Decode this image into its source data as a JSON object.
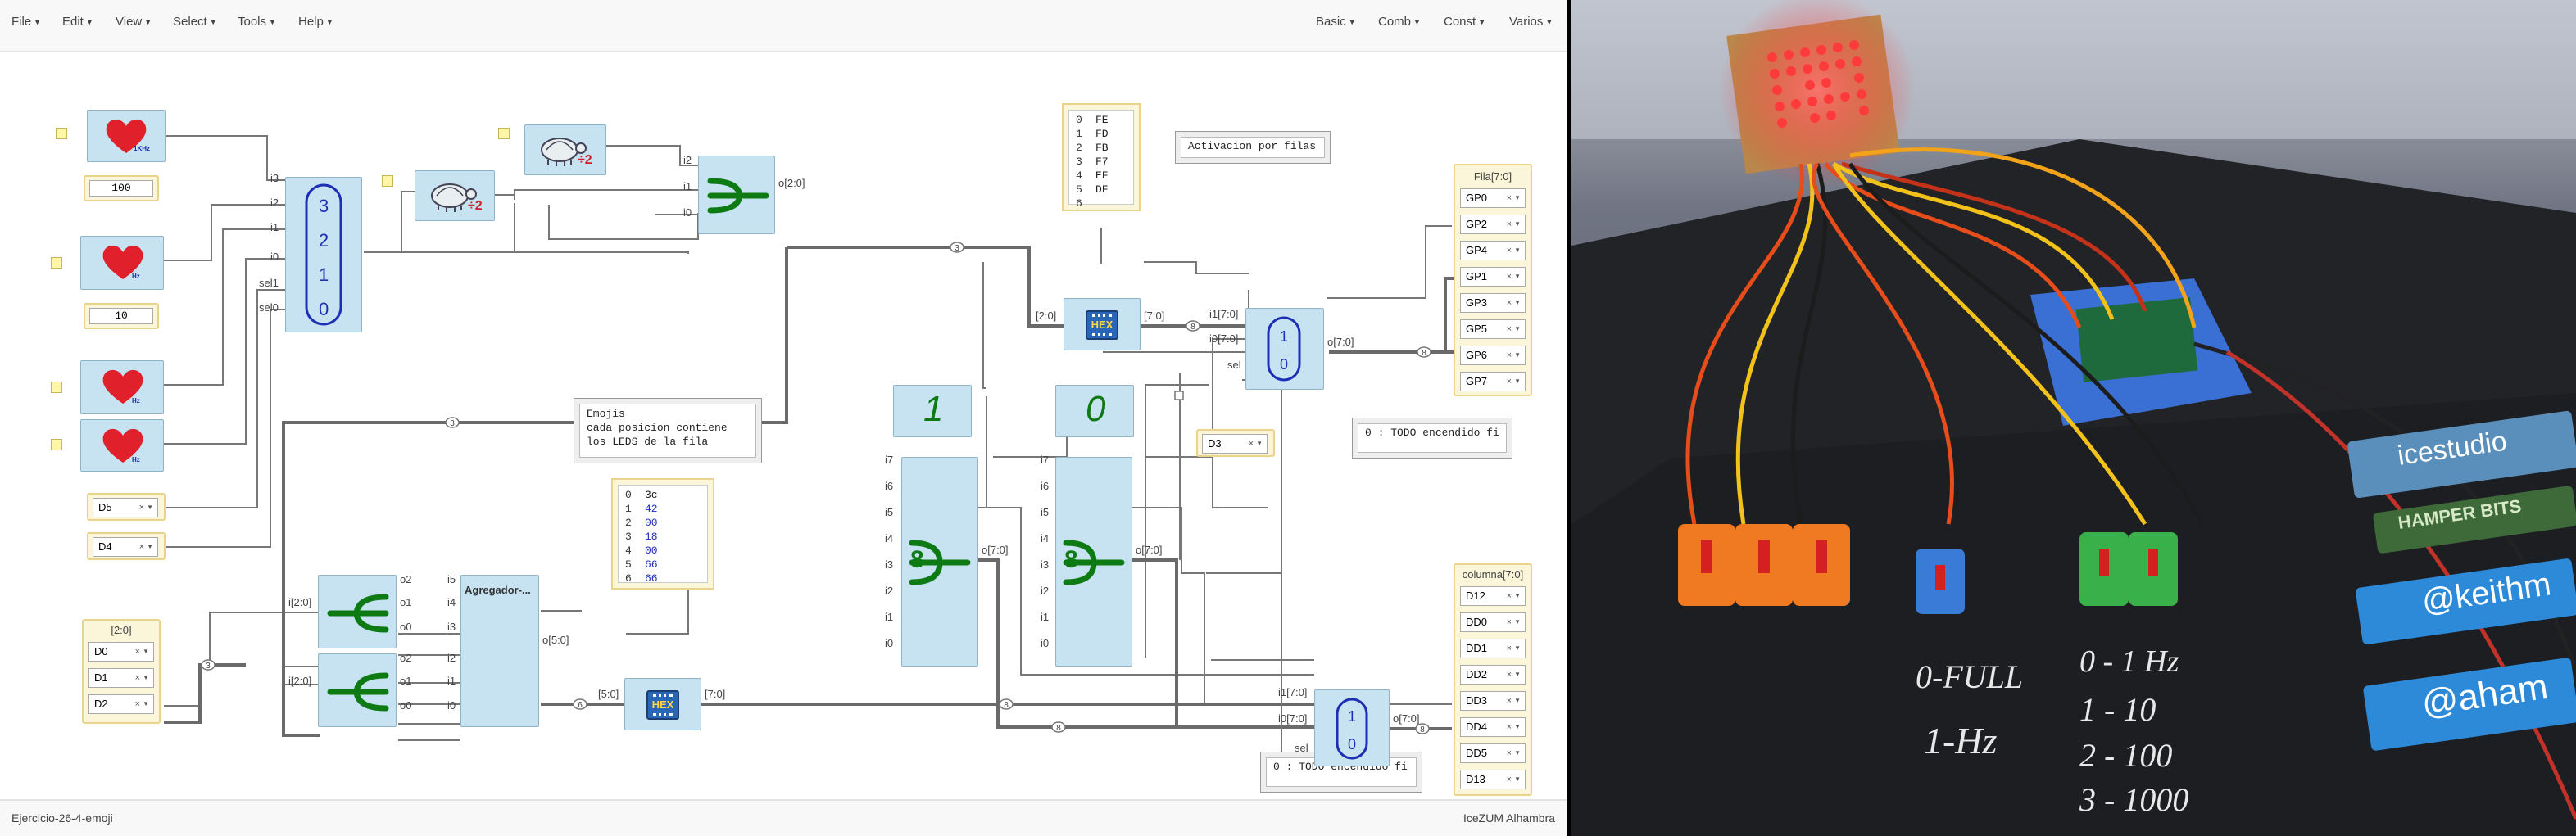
{
  "menu": {
    "left": [
      "File",
      "Edit",
      "View",
      "Select",
      "Tools",
      "Help"
    ],
    "right": [
      "Basic",
      "Comb",
      "Const",
      "Varios"
    ]
  },
  "status": {
    "project": "Ejercicio-26-4-emoji",
    "app": "IceZUM Alhambra"
  },
  "clocks": {
    "c1": "1KHz",
    "c2": "Hz",
    "c3": "Hz",
    "c4": "Hz"
  },
  "consts": {
    "k100": "100",
    "k10": "10"
  },
  "divider_label": "÷2",
  "inputs": {
    "d5": "D5",
    "d4": "D4",
    "d3": "D3"
  },
  "bus_in": {
    "title": "[2:0]",
    "pins": [
      "D0",
      "D1",
      "D2"
    ]
  },
  "fila": {
    "title": "Fila[7:0]",
    "pins": [
      "GP0",
      "GP2",
      "GP4",
      "GP1",
      "GP3",
      "GP5",
      "GP6",
      "GP7"
    ]
  },
  "columna": {
    "title": "columna[7:0]",
    "pins": [
      "D12",
      "DD0",
      "DD1",
      "DD2",
      "DD3",
      "DD4",
      "DD5",
      "D13"
    ]
  },
  "mux4": {
    "values": [
      "3",
      "2",
      "1",
      "0"
    ],
    "ports_in": [
      "i3",
      "i2",
      "i1",
      "i0",
      "sel1",
      "sel0"
    ]
  },
  "mux_small": {
    "ports": [
      "i2",
      "i1",
      "i0"
    ],
    "out": "o[2:0]"
  },
  "mem_rows": {
    "rows": [
      {
        "i": "0",
        "v": "FE"
      },
      {
        "i": "1",
        "v": "FD"
      },
      {
        "i": "2",
        "v": "FB"
      },
      {
        "i": "3",
        "v": "F7"
      },
      {
        "i": "4",
        "v": "EF"
      },
      {
        "i": "5",
        "v": "DF"
      },
      {
        "i": "6",
        "v": ""
      }
    ]
  },
  "mem_emoji": {
    "rows": [
      {
        "i": "0",
        "v": "3c"
      },
      {
        "i": "1",
        "v": "42"
      },
      {
        "i": "2",
        "v": "00"
      },
      {
        "i": "3",
        "v": "18"
      },
      {
        "i": "4",
        "v": "00"
      },
      {
        "i": "5",
        "v": "66"
      },
      {
        "i": "6",
        "v": "66"
      }
    ]
  },
  "notes": {
    "activacion": "Activacion por filas",
    "emojis": "Emojis\ncada posicion contiene\nlos LEDS de la fila",
    "todo1": "0 : TODO encendido fi",
    "todo2": "0 : TODO encendido fi"
  },
  "hex_label": "HEX",
  "agregador": "Agregador-...",
  "digits": {
    "one": "1",
    "zero": "0",
    "eight": "8"
  },
  "mux2": {
    "v1": "1",
    "v0": "0"
  },
  "port_labels": {
    "o_2_0": "o[2:0]",
    "hex_in": "[2:0]",
    "hex_out": "[7:0]",
    "i1_70": "i1[7:0]",
    "i0_70": "i0[7:0]",
    "o_70": "o[7:0]",
    "sel": "sel",
    "i_2_0": "i[2:0]",
    "o_5_0": "o[5:0]",
    "in_5_0": "[5:0]",
    "out_7_0": "[7:0]",
    "i7": "i7",
    "i6": "i6",
    "i5": "i5",
    "i4": "i4",
    "i3": "i3",
    "i2": "i2",
    "i1": "i1",
    "i0": "i0",
    "o2": "o2",
    "o1": "o1",
    "o0": "o0",
    "a_i5": "i5",
    "a_i4": "i4",
    "a_i3": "i3",
    "a_i2": "i2",
    "a_i1": "i1",
    "a_i0": "i0"
  },
  "bus_tags": {
    "b3a": "3",
    "b3b": "3",
    "b3c": "3",
    "b8a": "8",
    "b8b": "8",
    "b8c": "8",
    "b8d": "8",
    "b6": "6",
    "b8e": "8"
  },
  "photo": {
    "chalk": [
      "0-FULL",
      "1-Hz",
      "0 - 1 Hz",
      "1 - 10",
      "2 - 100",
      "3 - 1000"
    ],
    "sticker1": "icestudio",
    "sticker2": "HAMPER BITS",
    "sticker3": "@keithm",
    "sticker4": "@aham"
  },
  "colors": {
    "block": "#c7e3f2",
    "heart": "#e0202b",
    "accent_green": "#0e7a14",
    "mux_blue": "#1d2fb5"
  }
}
